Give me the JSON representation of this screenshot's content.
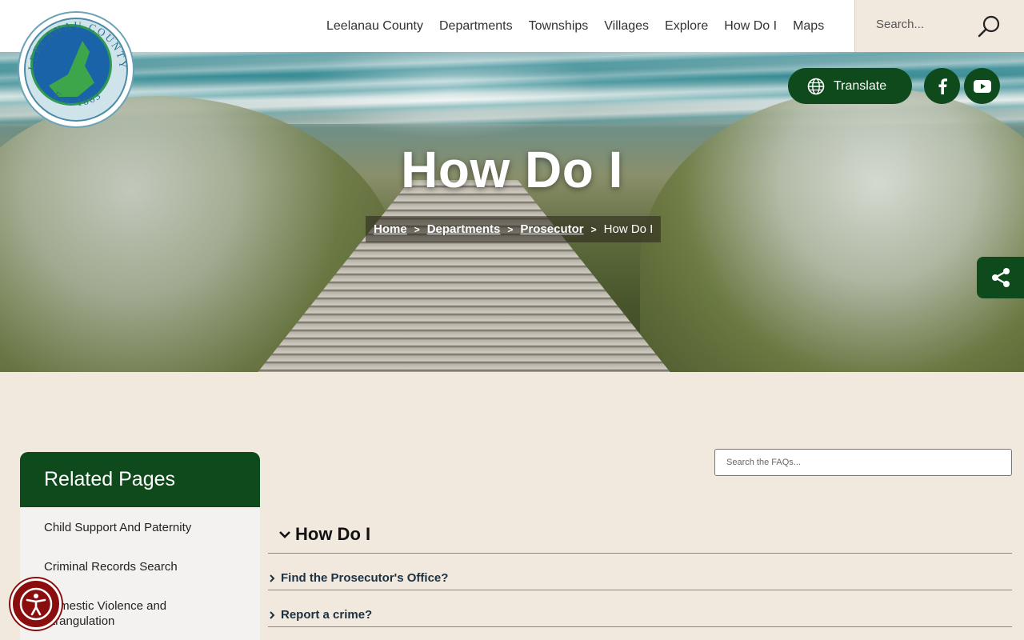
{
  "logo": {
    "arc_text": "LEELANAU COUNTY",
    "est_text": "Est. 1863"
  },
  "nav": {
    "items": [
      "Leelanau County",
      "Departments",
      "Townships",
      "Villages",
      "Explore",
      "How Do I",
      "Maps"
    ]
  },
  "search": {
    "placeholder": "Search..."
  },
  "hero": {
    "title": "How Do I",
    "breadcrumb": {
      "home": "Home",
      "departments": "Departments",
      "prosecutor": "Prosecutor",
      "current": "How Do I"
    }
  },
  "actions": {
    "translate_label": "Translate",
    "social": [
      "facebook-icon",
      "youtube-icon"
    ],
    "share": "share-icon"
  },
  "sidebar": {
    "title": "Related Pages",
    "items": [
      {
        "label": "Child Support And Paternity"
      },
      {
        "label": "Criminal Records Search"
      },
      {
        "label": "Domestic Violence and Strangulation"
      }
    ]
  },
  "faq": {
    "search_placeholder": "Search the FAQs...",
    "category": "How Do I",
    "questions": [
      "Find the Prosecutor's Office?",
      "Report a crime?"
    ]
  },
  "colors": {
    "brand_green": "#0f4a1c",
    "page_bg": "#f1e9de",
    "accessibility_red": "#8b0e0e"
  }
}
